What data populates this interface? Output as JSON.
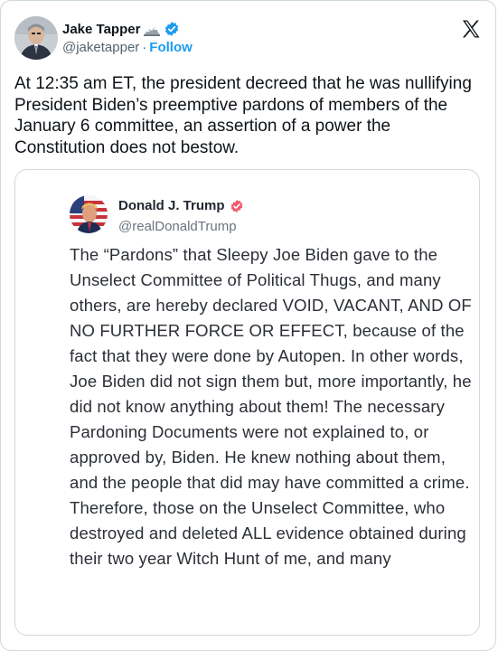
{
  "tweet": {
    "author_name": "Jake Tapper",
    "author_handle": "@jaketapper",
    "separator": "·",
    "follow_label": "Follow",
    "text": "At 12:35 am ET, the president decreed that he was nullifying President Biden’s preemptive pardons of members of the January 6 committee, an assertion of a power the Constitution does not bestow.",
    "icons": {
      "name_emoji": "bald-eagle-icon",
      "verified": "verified-badge-icon",
      "platform": "x-logo-icon"
    }
  },
  "embedded_post": {
    "author_name": "Donald J. Trump",
    "author_handle": "@realDonaldTrump",
    "text": "The “Pardons” that Sleepy Joe Biden gave to the Unselect Committee of Political Thugs, and many others, are hereby declared VOID, VACANT, AND OF NO FURTHER FORCE OR EFFECT, because of the fact that they were done by Autopen. In other words, Joe Biden did not sign them but, more importantly, he did not know anything about them! The necessary Pardoning Documents were not explained to, or approved by, Biden. He knew nothing about them, and the people that did may have committed a crime. Therefore, those on the Unselect Committee, who destroyed and deleted ALL evidence obtained during their two year Witch Hunt of me, and many",
    "icons": {
      "verified": "truth-social-verified-icon"
    }
  },
  "colors": {
    "accent": "#1d9bf0",
    "text_primary": "#0f1419",
    "text_secondary": "#536471",
    "border": "#cfd9de",
    "truth_verified": "#f25c6e"
  }
}
